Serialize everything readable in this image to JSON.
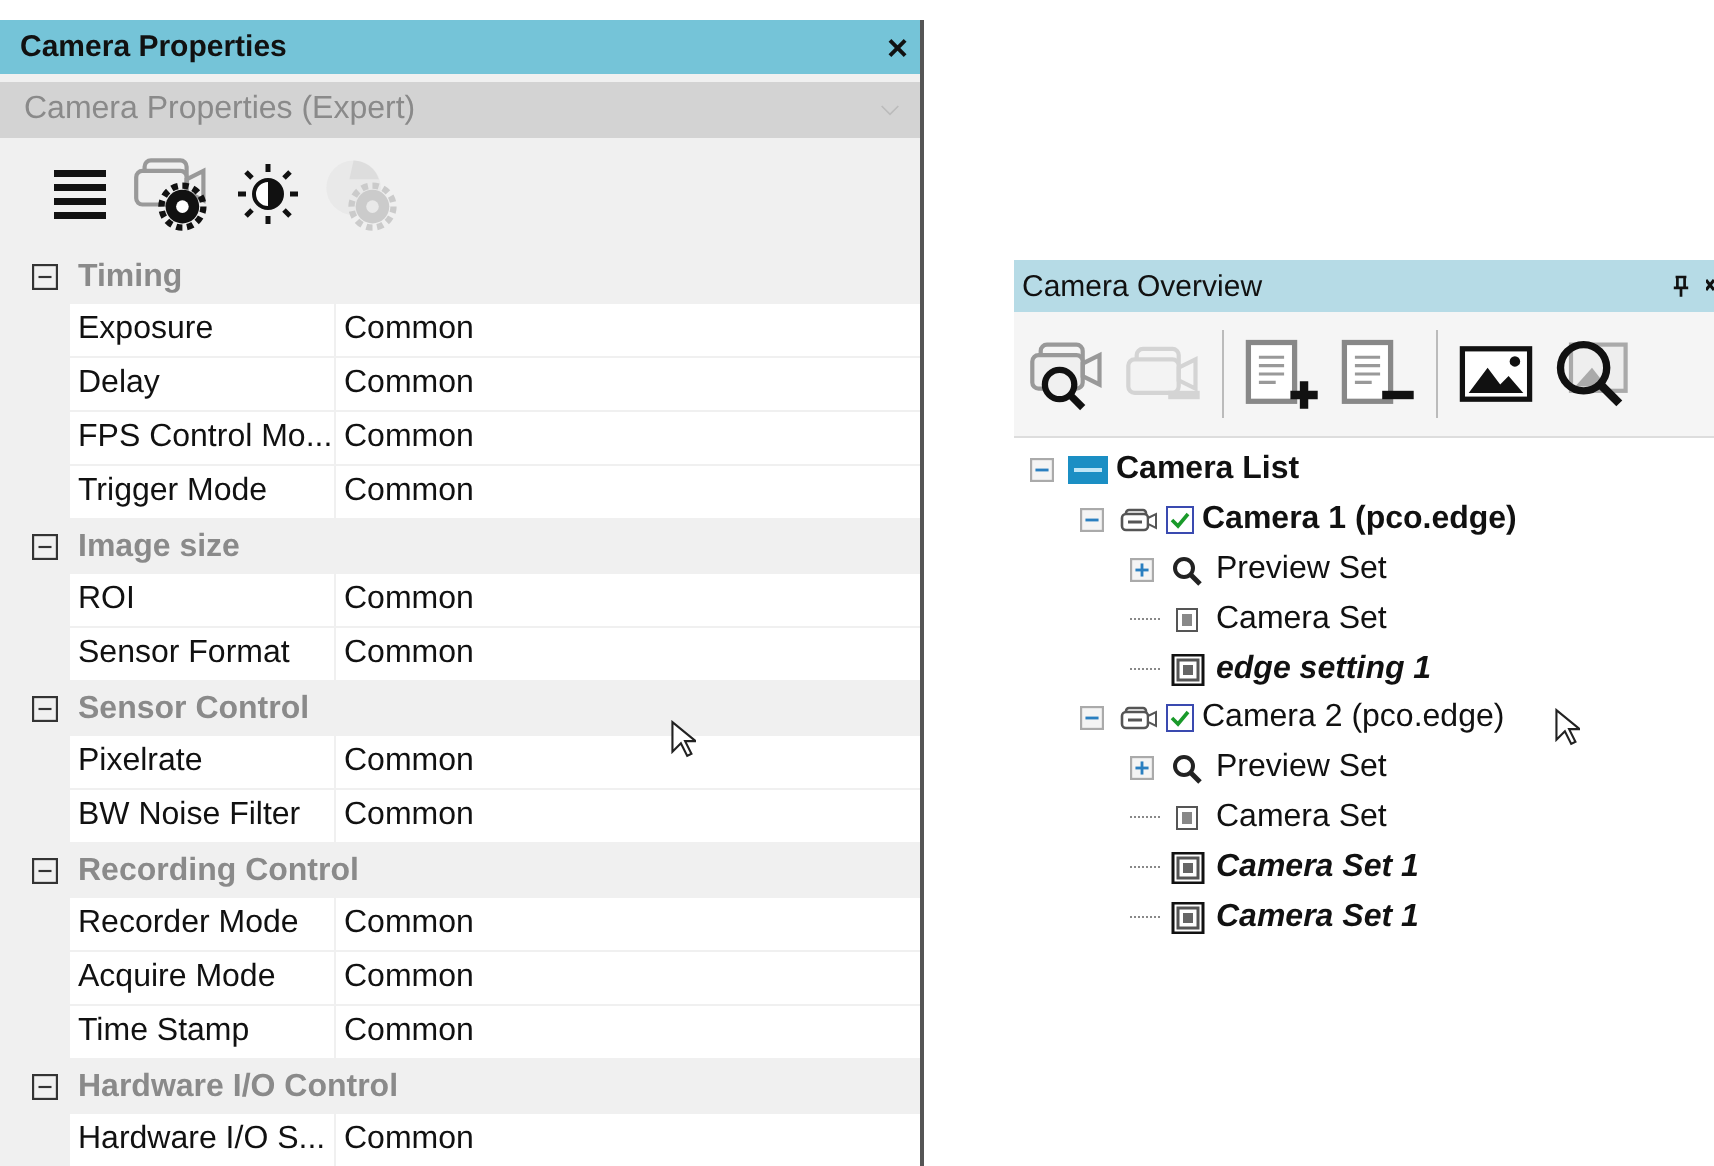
{
  "properties_panel": {
    "title": "Camera Properties",
    "close": "×",
    "view_select": {
      "value": "Camera Properties (Expert)",
      "disabled": true
    },
    "toolbar": [
      {
        "kind": "menu",
        "disabled": false
      },
      {
        "kind": "camera-gear",
        "disabled": false
      },
      {
        "kind": "brightness",
        "disabled": false
      },
      {
        "kind": "aperture-gear",
        "disabled": true
      }
    ],
    "groups": [
      {
        "name": "Timing",
        "expanded": true,
        "rows": [
          {
            "name": "Exposure",
            "value": "Common"
          },
          {
            "name": "Delay",
            "value": "Common"
          },
          {
            "name": "FPS Control Mo...",
            "value": "Common"
          },
          {
            "name": "Trigger Mode",
            "value": "Common"
          }
        ]
      },
      {
        "name": "Image size",
        "expanded": true,
        "rows": [
          {
            "name": "ROI",
            "value": "Common"
          },
          {
            "name": "Sensor Format",
            "value": "Common"
          }
        ]
      },
      {
        "name": "Sensor Control",
        "expanded": true,
        "rows": [
          {
            "name": "Pixelrate",
            "value": "Common"
          },
          {
            "name": "BW Noise Filter",
            "value": "Common"
          }
        ]
      },
      {
        "name": "Recording Control",
        "expanded": true,
        "rows": [
          {
            "name": "Recorder Mode",
            "value": "Common"
          },
          {
            "name": "Acquire Mode",
            "value": "Common"
          },
          {
            "name": "Time Stamp",
            "value": "Common"
          }
        ]
      },
      {
        "name": "Hardware I/O Control",
        "expanded": true,
        "rows": [
          {
            "name": "Hardware I/O S...",
            "value": "Common"
          }
        ]
      }
    ]
  },
  "overview_panel": {
    "title": "Camera Overview",
    "toolbar": [
      [
        {
          "kind": "camera-search",
          "disabled": false
        },
        {
          "kind": "camera",
          "disabled": true
        }
      ],
      [
        {
          "kind": "doc-plus",
          "disabled": false
        },
        {
          "kind": "doc-minus",
          "disabled": false
        }
      ],
      [
        {
          "kind": "image",
          "disabled": false
        },
        {
          "kind": "image-search",
          "disabled": false
        }
      ]
    ],
    "tree": [
      {
        "kind": "root",
        "label": "Camera List",
        "bold": true,
        "italic": false,
        "expanded": true,
        "children": [
          {
            "kind": "camera",
            "label": "Camera 1 (pco.edge)",
            "bold": true,
            "italic": false,
            "checked": true,
            "expanded": true,
            "children": [
              {
                "kind": "preview",
                "label": "Preview Set",
                "bold": false,
                "italic": false,
                "expanded": false
              },
              {
                "kind": "set",
                "label": "Camera Set",
                "bold": false,
                "italic": false
              },
              {
                "kind": "active-set",
                "label": "edge setting 1",
                "bold": true,
                "italic": true
              }
            ]
          },
          {
            "kind": "camera",
            "label": "Camera 2 (pco.edge)",
            "bold": false,
            "italic": false,
            "checked": true,
            "expanded": true,
            "children": [
              {
                "kind": "preview",
                "label": "Preview Set",
                "bold": false,
                "italic": false,
                "expanded": false
              },
              {
                "kind": "set",
                "label": "Camera Set",
                "bold": false,
                "italic": false
              },
              {
                "kind": "active-set",
                "label": "Camera Set 1",
                "bold": true,
                "italic": true
              },
              {
                "kind": "active-set",
                "label": "Camera Set 1",
                "bold": true,
                "italic": true
              }
            ]
          }
        ]
      }
    ]
  }
}
